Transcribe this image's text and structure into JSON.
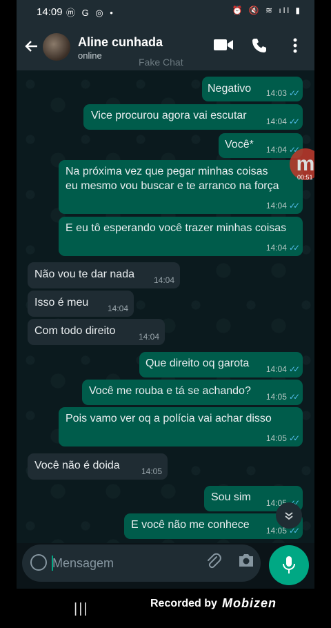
{
  "status_bar": {
    "time": "14:09",
    "left_icons": "ⓜ G ◎ •",
    "right_icons": "⏰ 🔇 ≋ ıll ▮"
  },
  "header": {
    "contact_name": "Aline cunhada",
    "contact_status": "online",
    "watermark": "Fake Chat"
  },
  "messages": [
    {
      "text": "Negativo",
      "time": "14:03",
      "direction": "out"
    },
    {
      "text": "Vice procurou agora vai escutar",
      "time": "14:04",
      "direction": "out"
    },
    {
      "text": "Você*",
      "time": "14:04",
      "direction": "out"
    },
    {
      "line1": "Na próxima vez que pegar minhas coisas",
      "line2": "eu mesmo vou buscar e te arranco na força",
      "time": "14:04",
      "direction": "out"
    },
    {
      "text": "E eu tô esperando você trazer minhas coisas",
      "time": "14:04",
      "direction": "out"
    },
    {
      "text": "Não vou te dar nada",
      "time": "14:04",
      "direction": "in"
    },
    {
      "text": "Isso é meu",
      "time": "14:04",
      "direction": "in"
    },
    {
      "text": "Com todo direito",
      "time": "14:04",
      "direction": "in"
    },
    {
      "text": "Que direito oq garota",
      "time": "14:04",
      "direction": "out"
    },
    {
      "text": "Você me rouba e tá se achando?",
      "time": "14:05",
      "direction": "out"
    },
    {
      "text": "Pois vamo ver oq a polícia vai achar disso",
      "time": "14:05",
      "direction": "out"
    },
    {
      "text": "Você não é doida",
      "time": "14:05",
      "direction": "in"
    },
    {
      "text": "Sou sim",
      "time": "14:05",
      "direction": "out"
    },
    {
      "text": "E você não me conhece",
      "time": "14:05",
      "direction": "out"
    }
  ],
  "input": {
    "placeholder": "Mensagem"
  },
  "overlay": {
    "rec_badge": "m",
    "rec_timer": "00:51",
    "recorded_by": "Recorded by",
    "recorder_brand": "Mobizen"
  },
  "icons": {
    "back": "arrow-left-icon",
    "video": "video-camera-icon",
    "call": "phone-icon",
    "menu": "more-vertical-icon"
  },
  "colors": {
    "outgoing": "#005c4b",
    "incoming": "#1f2c33",
    "accent": "#00a884",
    "read_tick": "#53bdeb"
  }
}
